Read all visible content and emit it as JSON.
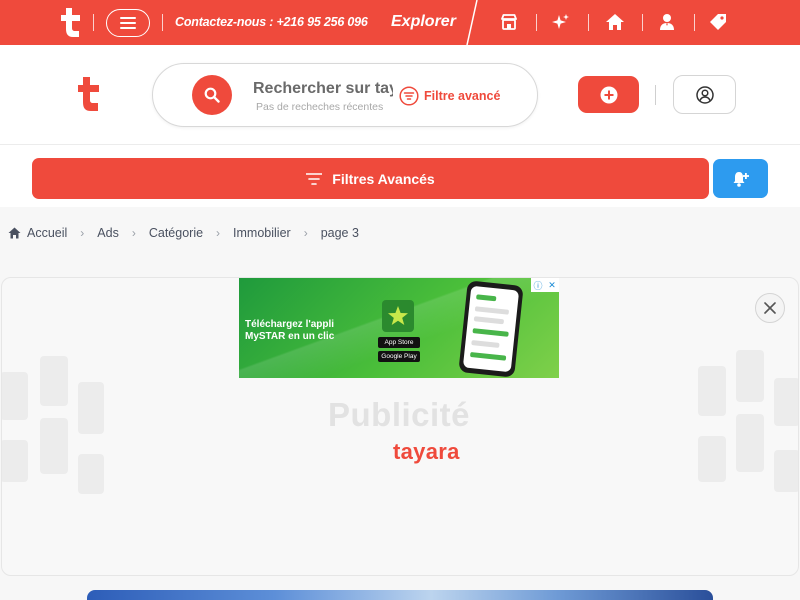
{
  "topbar": {
    "contact_text": "Contactez-nous : +216 95 256 096",
    "explorer_label": "Explorer",
    "nav_icons": [
      "shop-icon",
      "sparkles-icon",
      "home-icon",
      "user-tie-icon",
      "tag-icon"
    ]
  },
  "search": {
    "placeholder": "Rechercher sur tayara",
    "recent_text": "Pas de recheches récentes",
    "filter_link_label": "Filtre avancé"
  },
  "filters": {
    "button_label": "Filtres Avancés"
  },
  "breadcrumb": {
    "items": [
      "Accueil",
      "Ads",
      "Catégorie",
      "Immobilier",
      "page 3"
    ]
  },
  "ad": {
    "banner_line1": "Téléchargez l'appli",
    "banner_line2": "MySTAR en un clic",
    "store1": "App Store",
    "store2": "Google Play",
    "placeholder_title": "Publicité",
    "placeholder_brand": "tayara"
  },
  "colors": {
    "brand_red": "#ef4a3c",
    "alert_blue": "#2d9bef"
  }
}
